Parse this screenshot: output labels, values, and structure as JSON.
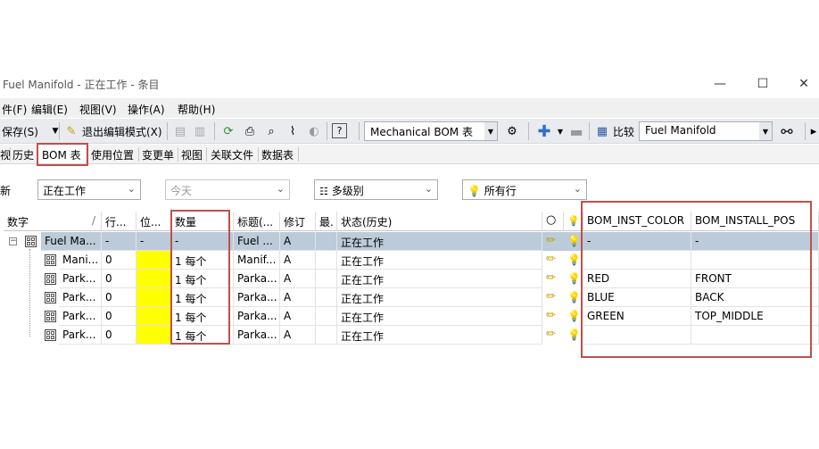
{
  "window": {
    "title": "Fuel Manifold - 正在工作 - 条目",
    "minimize": "—",
    "maximize": "☐",
    "close": "✕"
  },
  "menu": [
    "件(F)",
    "编辑(E)",
    "视图(V)",
    "操作(A)",
    "帮助(H)"
  ],
  "toolbar": {
    "save": "保存(S)",
    "exit_edit": "退出编辑模式(X)",
    "bom_view": "Mechanical BOM 表",
    "compare": "比较",
    "compare_target": "Fuel Manifold",
    "help_icon": "?"
  },
  "tabs": [
    "视",
    "历史",
    "BOM 表",
    "使用位置",
    "变更单",
    "视图",
    "关联文件",
    "数据表"
  ],
  "filters": {
    "revision_prefix": "新",
    "revision": "正在工作",
    "date_placeholder": "今天",
    "level": "多级别",
    "rows": "所有行"
  },
  "grid": {
    "columns": [
      "数字",
      "行...",
      "位...",
      "数量",
      "标题(...",
      "修订",
      "最.",
      "状态(历史)",
      "BOM_INST_COLOR",
      "BOM_INSTALL_POS"
    ],
    "rows": [
      {
        "number": "Fuel Ma...",
        "line": "-",
        "pos": "-",
        "qty": "-",
        "title": "Fuel ...",
        "rev": "A",
        "latest": "",
        "state": "正在工作",
        "color": "-",
        "install_pos": "-"
      },
      {
        "number": "Mani...",
        "line": "0",
        "pos": "",
        "qty": "1 每个",
        "title": "Manif...",
        "rev": "A",
        "latest": "",
        "state": "正在工作",
        "color": "",
        "install_pos": ""
      },
      {
        "number": "Park...",
        "line": "0",
        "pos": "",
        "qty": "1 每个",
        "title": "Parka...",
        "rev": "A",
        "latest": "",
        "state": "正在工作",
        "color": "RED",
        "install_pos": "FRONT"
      },
      {
        "number": "Park...",
        "line": "0",
        "pos": "",
        "qty": "1 每个",
        "title": "Parka...",
        "rev": "A",
        "latest": "",
        "state": "正在工作",
        "color": "BLUE",
        "install_pos": "BACK"
      },
      {
        "number": "Park...",
        "line": "0",
        "pos": "",
        "qty": "1 每个",
        "title": "Parka...",
        "rev": "A",
        "latest": "",
        "state": "正在工作",
        "color": "GREEN",
        "install_pos": "TOP_MIDDLE"
      },
      {
        "number": "Park...",
        "line": "0",
        "pos": "",
        "qty": "1 每个",
        "title": "Parka...",
        "rev": "A",
        "latest": "",
        "state": "正在工作",
        "color": "",
        "install_pos": ""
      }
    ]
  },
  "colors": {
    "selected_row": "#bccbd9",
    "position_highlight": "#ffff00",
    "annotation_box": "#c0504d"
  }
}
